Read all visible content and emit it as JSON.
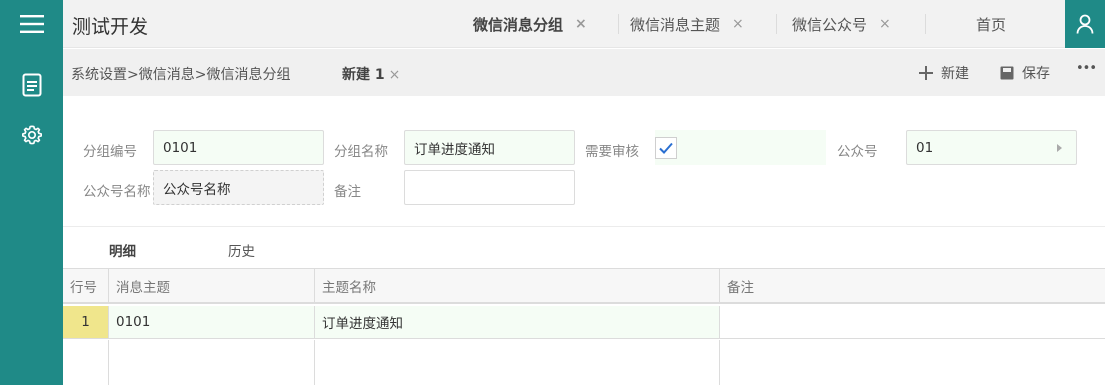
{
  "app": {
    "title": "测试开发"
  },
  "header": {
    "tabs": [
      {
        "label": "微信消息分组",
        "closable": true,
        "active": true
      },
      {
        "label": "微信消息主题",
        "closable": true,
        "active": false
      },
      {
        "label": "微信公众号",
        "closable": true,
        "active": false
      },
      {
        "label": "首页",
        "closable": false,
        "active": false
      }
    ],
    "close_glyph": "×"
  },
  "sidebar": {
    "icons": [
      "menu-icon",
      "document-icon",
      "gear-icon"
    ]
  },
  "breadcrumb": {
    "text": "系统设置>微信消息>微信消息分组"
  },
  "doc_tab": {
    "label": "新建 1",
    "close_glyph": "×"
  },
  "toolbar": {
    "new_label": "新建",
    "save_label": "保存",
    "more_label": "•••"
  },
  "form": {
    "group_code": {
      "label": "分组编号",
      "value": "0101"
    },
    "group_name": {
      "label": "分组名称",
      "value": "订单进度通知"
    },
    "need_review": {
      "label": "需要审核",
      "checked": true
    },
    "account": {
      "label": "公众号",
      "value": "01"
    },
    "account_name": {
      "label": "公众号名称",
      "value": "公众号名称"
    },
    "remark": {
      "label": "备注",
      "value": ""
    }
  },
  "detail_tabs": [
    {
      "label": "明细",
      "active": true
    },
    {
      "label": "历史",
      "active": false
    }
  ],
  "grid": {
    "columns": [
      "行号",
      "消息主题",
      "主题名称",
      "备注"
    ],
    "rows": [
      [
        "1",
        "0101",
        "订单进度通知",
        ""
      ]
    ]
  },
  "colors": {
    "accent": "#1f8a87",
    "row_number_bg": "#f0e68c",
    "field_bg": "#f5fdf5"
  }
}
